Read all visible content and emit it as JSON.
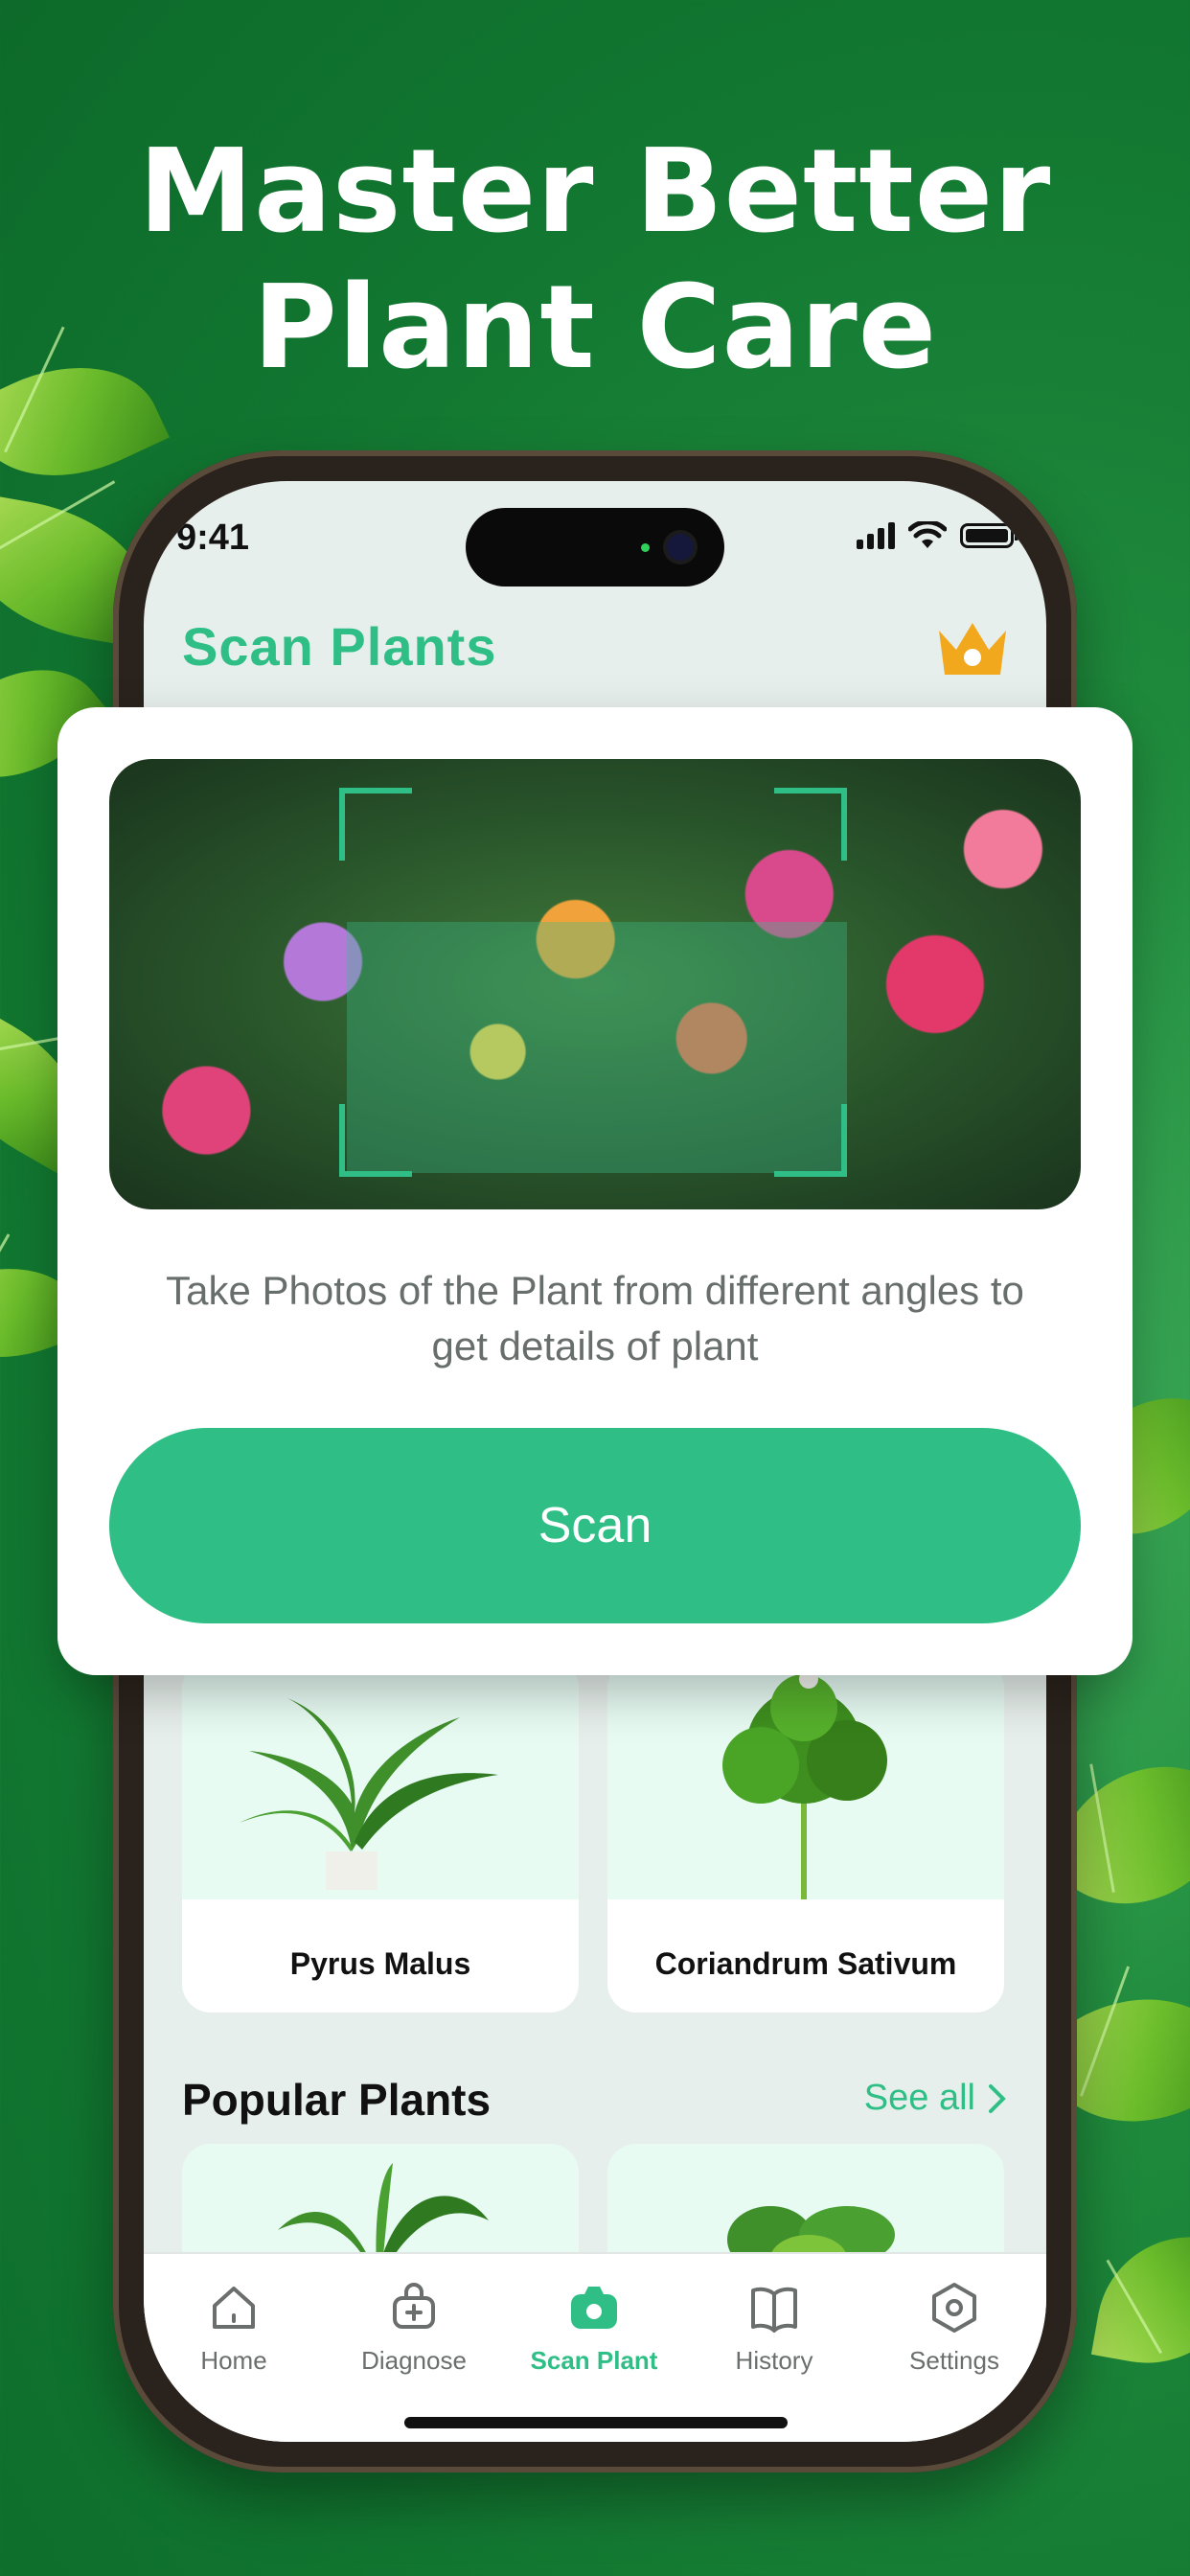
{
  "headline": {
    "line1": "Master Better",
    "line2": "Plant Care"
  },
  "status_bar": {
    "time": "9:41"
  },
  "header": {
    "title": "Scan Plants",
    "premium_icon": "crown-icon"
  },
  "scan_card": {
    "instruction": "Take Photos of the Plant from different angles to get details of plant",
    "button_label": "Scan"
  },
  "plants": [
    {
      "name": "Pyrus Malus"
    },
    {
      "name": "Coriandrum Sativum"
    }
  ],
  "popular": {
    "title": "Popular Plants",
    "see_all": "See all"
  },
  "tabs": [
    {
      "label": "Home",
      "icon": "home-icon"
    },
    {
      "label": "Diagnose",
      "icon": "diagnose-bag-icon"
    },
    {
      "label": "Scan Plant",
      "icon": "camera-icon",
      "active": true
    },
    {
      "label": "History",
      "icon": "book-icon"
    },
    {
      "label": "Settings",
      "icon": "settings-hexagon-icon"
    }
  ],
  "colors": {
    "accent": "#2fbf86",
    "background_green": "#1f8a3c",
    "crown": "#f2a81d"
  }
}
